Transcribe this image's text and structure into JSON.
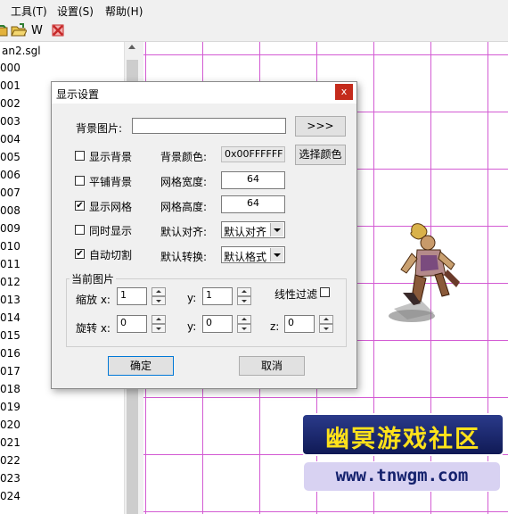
{
  "menu": {
    "tools": "工具(T)",
    "settings": "设置(S)",
    "help": "帮助(H)"
  },
  "toolbar": {
    "w_label": "W"
  },
  "tree": {
    "root": "an2.sgl",
    "items": [
      "000",
      "001",
      "002",
      "003",
      "004",
      "005",
      "006",
      "007",
      "008",
      "009",
      "010",
      "011",
      "012",
      "013",
      "014",
      "015",
      "016",
      "017",
      "018",
      "019",
      "020",
      "021",
      "022",
      "023",
      "024"
    ]
  },
  "watermark": {
    "title": "幽冥游戏社区",
    "url": "www.tnwgm.com"
  },
  "dialog": {
    "title": "显示设置",
    "close": "x",
    "bg_image_label": "背景图片:",
    "bg_image_value": "",
    "browse_button": ">>>",
    "show_bg_label": "显示背景",
    "show_bg_checked": false,
    "tile_bg_label": "平铺背景",
    "tile_bg_checked": false,
    "show_grid_label": "显示网格",
    "show_grid_checked": true,
    "simul_label": "同时显示",
    "simul_checked": false,
    "autocut_label": "自动切割",
    "autocut_checked": true,
    "bg_color_label": "背景颜色:",
    "bg_color_value": "0x00FFFFFF",
    "pick_color_button": "选择颜色",
    "grid_width_label": "网格宽度:",
    "grid_width_value": "64",
    "grid_height_label": "网格高度:",
    "grid_height_value": "64",
    "align_label": "默认对齐:",
    "align_value": "默认对齐",
    "convert_label": "默认转换:",
    "convert_value": "默认格式",
    "current_group": "当前图片",
    "scale_x_label": "缩放 x:",
    "scale_x_value": "1",
    "scale_y_label": "y:",
    "scale_y_value": "1",
    "linear_filter_label": "线性过滤",
    "linear_filter_checked": false,
    "rot_x_label": "旋转 x:",
    "rot_x_value": "0",
    "rot_y_label": "y:",
    "rot_y_value": "0",
    "rot_z_label": "z:",
    "rot_z_value": "0",
    "ok_button": "确定",
    "cancel_button": "取消"
  }
}
